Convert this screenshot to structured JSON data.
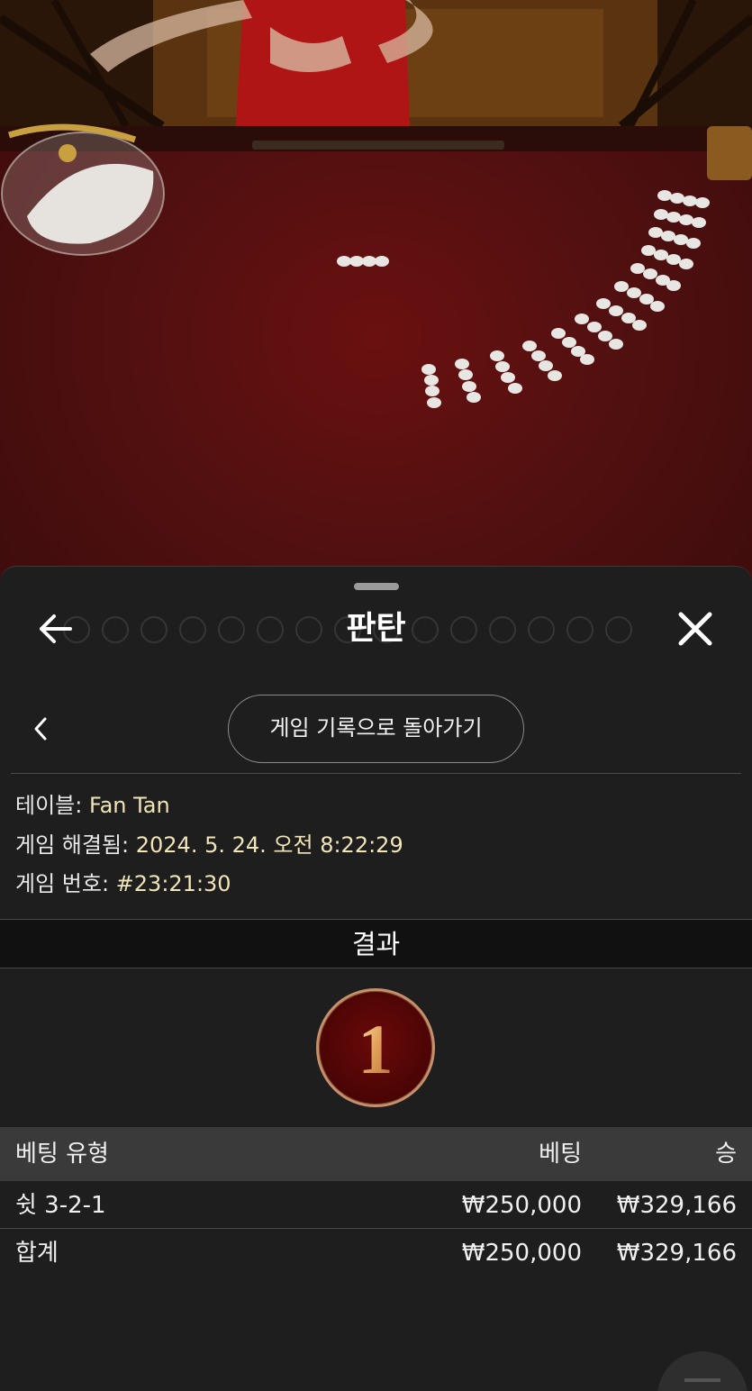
{
  "sheet": {
    "title": "판탄",
    "history_button": "게임 기록으로 돌아가기",
    "accent_color": "#f1e4b8"
  },
  "game_info": {
    "table_label": "테이블: ",
    "table_value": "Fan Tan",
    "resolved_label": "게임 해결됨: ",
    "resolved_value": "2024. 5. 24. 오전 8:22:29",
    "number_label": "게임 번호: ",
    "number_value": "#23:21:30"
  },
  "result": {
    "header": "결과",
    "value": "1"
  },
  "bets_table": {
    "columns": [
      "베팅 유형",
      "베팅",
      "승"
    ],
    "rows": [
      {
        "type": "쉿 3-2-1",
        "bet": "₩250,000",
        "win": "₩329,166"
      }
    ],
    "total": {
      "label": "합계",
      "bet": "₩250,000",
      "win": "₩329,166"
    }
  },
  "icons": [
    "back-arrow-icon",
    "close-icon",
    "chevron-left-icon",
    "menu-icon"
  ]
}
